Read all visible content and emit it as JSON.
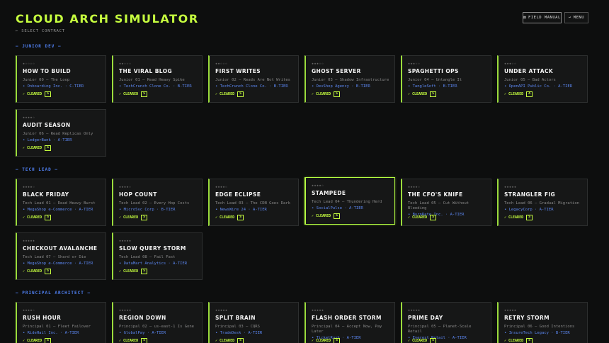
{
  "header": {
    "title": "CLOUD ARCH SIMULATOR",
    "subtitle": "← SELECT CONTRACT",
    "field_manual_label": "FIELD MANUAL",
    "menu_label": "MENU"
  },
  "sections": [
    {
      "label": "— JUNIOR DEV —",
      "cards": [
        {
          "stars": "★☆☆☆☆",
          "title": "HOW TO BUILD",
          "desc": "Junior 00 — The Loop",
          "client": "• Onboarding Inc. · C-TIER",
          "status": "✓ CLEARED",
          "grade": "S"
        },
        {
          "stars": "★★☆☆☆",
          "title": "THE VIRAL BLOG",
          "desc": "Junior 01 — Read Heavy Spike",
          "client": "• TechCrunch Clone Co. · B-TIER",
          "status": "✓ CLEARED",
          "grade": "S"
        },
        {
          "stars": "★★☆☆☆",
          "title": "FIRST WRITES",
          "desc": "Junior 02 — Reads Are Not Writes",
          "client": "• TechCrunch Clone Co. · B-TIER",
          "status": "✓ CLEARED",
          "grade": "S"
        },
        {
          "stars": "★★★☆☆",
          "title": "GHOST SERVER",
          "desc": "Junior 03 — Shadow Infrastructure",
          "client": "• DevShop Agency · B-TIER",
          "status": "✓ CLEARED",
          "grade": "S"
        },
        {
          "stars": "★★★☆☆",
          "title": "SPAGHETTI OPS",
          "desc": "Junior 04 — Untangle It",
          "client": "• TangleSoft · B-TIER",
          "status": "✓ CLEARED",
          "grade": "S"
        },
        {
          "stars": "★★★☆☆",
          "title": "UNDER ATTACK",
          "desc": "Junior 05 — Bad Actors",
          "client": "• OpenAPI Public Co. · A-TIER",
          "status": "✓ CLEARED",
          "grade": "A"
        },
        {
          "stars": "★★★★☆",
          "title": "AUDIT SEASON",
          "desc": "Junior 06 — Read Replicas Only",
          "client": "• LedgerBank · A-TIER",
          "status": "✓ CLEARED",
          "grade": "S"
        }
      ]
    },
    {
      "label": "— TECH LEAD —",
      "cards": [
        {
          "stars": "★★★★☆",
          "title": "BLACK FRIDAY",
          "desc": "Tech Lead 01 — Read Heavy Burst",
          "client": "• MegaShop e-Commerce · A-TIER",
          "status": "✓ CLEARED",
          "grade": "S"
        },
        {
          "stars": "★★★★☆",
          "title": "HOP COUNT",
          "desc": "Tech Lead 02 — Every Hop Costs",
          "client": "• MicroSvc Corp · B-TIER",
          "status": "✓ CLEARED",
          "grade": "S"
        },
        {
          "stars": "★★★★☆",
          "title": "EDGE ECLIPSE",
          "desc": "Tech Lead 03 — The CDN Goes Dark",
          "client": "• NewsWire 24 · A-TIER",
          "status": "✓ CLEARED",
          "grade": "S"
        },
        {
          "stars": "★★★★☆",
          "title": "STAMPEDE",
          "desc": "Tech Lead 04 — Thundering Herd",
          "client": "• SocialPulse · A-TIER",
          "status": "✓ CLEARED",
          "grade": "S",
          "highlight": true
        },
        {
          "stars": "★★★★☆",
          "title": "THE CFO'S KNIFE",
          "desc": "Tech Lead 05 — Cut Without Bleeding",
          "client": "• BurnRate Inc. · A-TIER",
          "status": "✓ CLEARED",
          "grade": "S"
        },
        {
          "stars": "★★★★★",
          "title": "STRANGLER FIG",
          "desc": "Tech Lead 06 — Gradual Migration",
          "client": "• LegacyCorp · A-TIER",
          "status": "✓ CLEARED",
          "grade": "S"
        },
        {
          "stars": "★★★★★",
          "title": "CHECKOUT AVALANCHE",
          "desc": "Tech Lead 07 — Shard or Die",
          "client": "• MegaShop e-Commerce · A-TIER",
          "status": "✓ CLEARED",
          "grade": "S"
        },
        {
          "stars": "★★★★★",
          "title": "SLOW QUERY STORM",
          "desc": "Tech Lead 08 — Fail Fast",
          "client": "• DataMart Analytics · A-TIER",
          "status": "✓ CLEARED",
          "grade": "S"
        }
      ]
    },
    {
      "label": "— PRINCIPAL ARCHITECT —",
      "cards": [
        {
          "stars": "★★★★☆",
          "title": "RUSH HOUR",
          "desc": "Principal 01 — Fleet Failover",
          "client": "• RideHail Inc. · A-TIER",
          "status": "✓ CLEARED",
          "grade": "S"
        },
        {
          "stars": "★★★★★",
          "title": "REGION DOWN",
          "desc": "Principal 02 — us-east-1 Is Gone",
          "client": "• GlobalPay · A-TIER",
          "status": "✓ CLEARED",
          "grade": "S"
        },
        {
          "stars": "★★★★★",
          "title": "SPLIT BRAIN",
          "desc": "Principal 03 — CQRS",
          "client": "• TradeDesk · A-TIER",
          "status": "✓ CLEARED",
          "grade": "S"
        },
        {
          "stars": "★★★★★",
          "title": "FLASH ORDER STORM",
          "desc": "Principal 04 — Accept Now, Pay Later",
          "client": "• TicketRush · A-TIER",
          "status": "✓ CLEARED",
          "grade": "S"
        },
        {
          "stars": "★★★★★",
          "title": "PRIME DAY",
          "desc": "Principal 05 — Planet-Scale Retail",
          "client": "• Everest Retail · A-TIER",
          "status": "✓ CLEARED",
          "grade": "S"
        },
        {
          "stars": "★★★★★",
          "title": "RETRY STORM",
          "desc": "Principal 06 — Good Intentions",
          "client": "• InsureTech Legacy · B-TIER",
          "status": "✓ CLEARED",
          "grade": "S"
        }
      ]
    }
  ],
  "colors": {
    "accent": "#c6ff3f",
    "section": "#4f7ff0",
    "client": "#5b86f0",
    "background": "#0d0e0e"
  }
}
